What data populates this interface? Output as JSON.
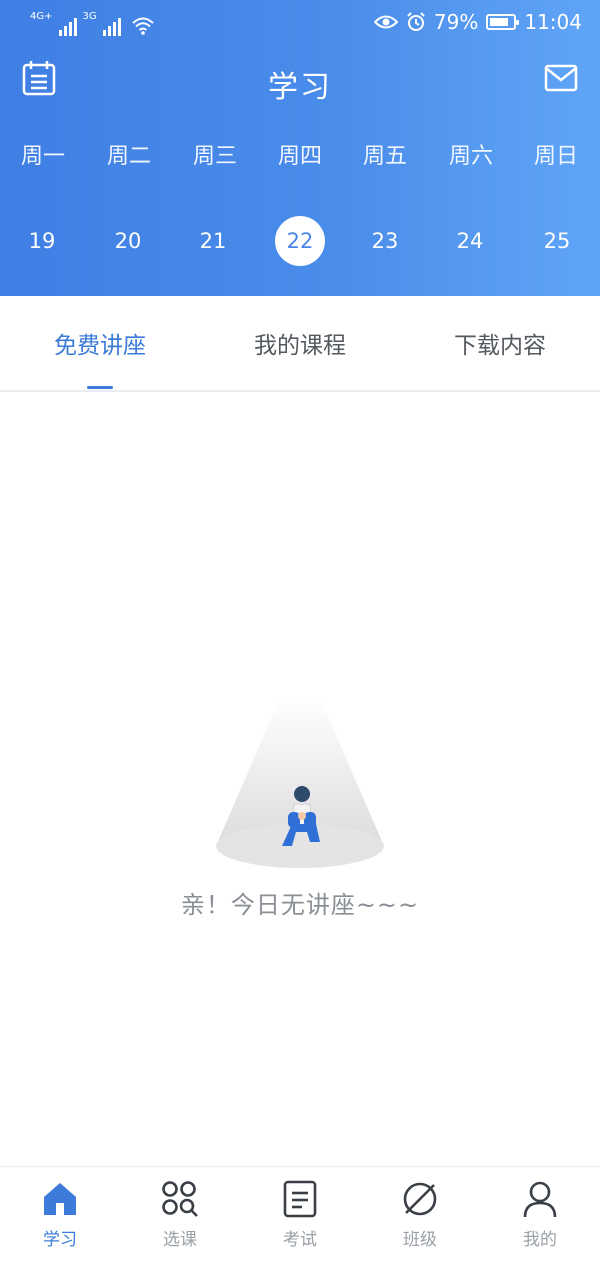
{
  "status_bar": {
    "network_1": "4G+",
    "network_2": "3G",
    "battery_text": "79%",
    "battery_level": 0.79,
    "time": "11:04"
  },
  "header": {
    "title": "学习",
    "calendar_icon": "calendar-icon",
    "mail_icon": "mail-icon"
  },
  "week": {
    "days": [
      "周一",
      "周二",
      "周三",
      "周四",
      "周五",
      "周六",
      "周日"
    ],
    "dates": [
      "19",
      "20",
      "21",
      "22",
      "23",
      "24",
      "25"
    ],
    "selected": "22"
  },
  "tabs": [
    "免费讲座",
    "我的课程",
    "下载内容"
  ],
  "empty_state": {
    "message": "亲！今日无讲座~~~"
  },
  "bottom_nav": [
    "学习",
    "选课",
    "考试",
    "班级",
    "我的"
  ],
  "colors": {
    "accent": "#3c7bd9",
    "header_start": "#3f7fe4",
    "header_end": "#5fa5f7",
    "muted": "#9aa0a7"
  }
}
